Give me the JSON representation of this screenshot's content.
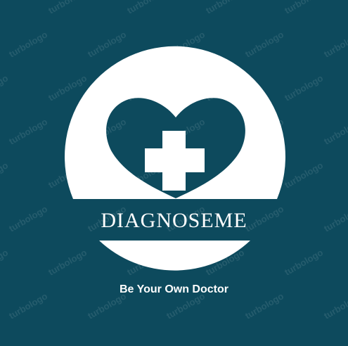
{
  "brand": {
    "name": "DIAGNOSEME",
    "tagline": "Be Your Own Doctor"
  },
  "watermark": {
    "text": "turbologo"
  },
  "icons": {
    "emblem": "heart-with-medical-cross-icon"
  },
  "colors": {
    "background": "#0d4a5d",
    "foreground": "#ffffff"
  }
}
